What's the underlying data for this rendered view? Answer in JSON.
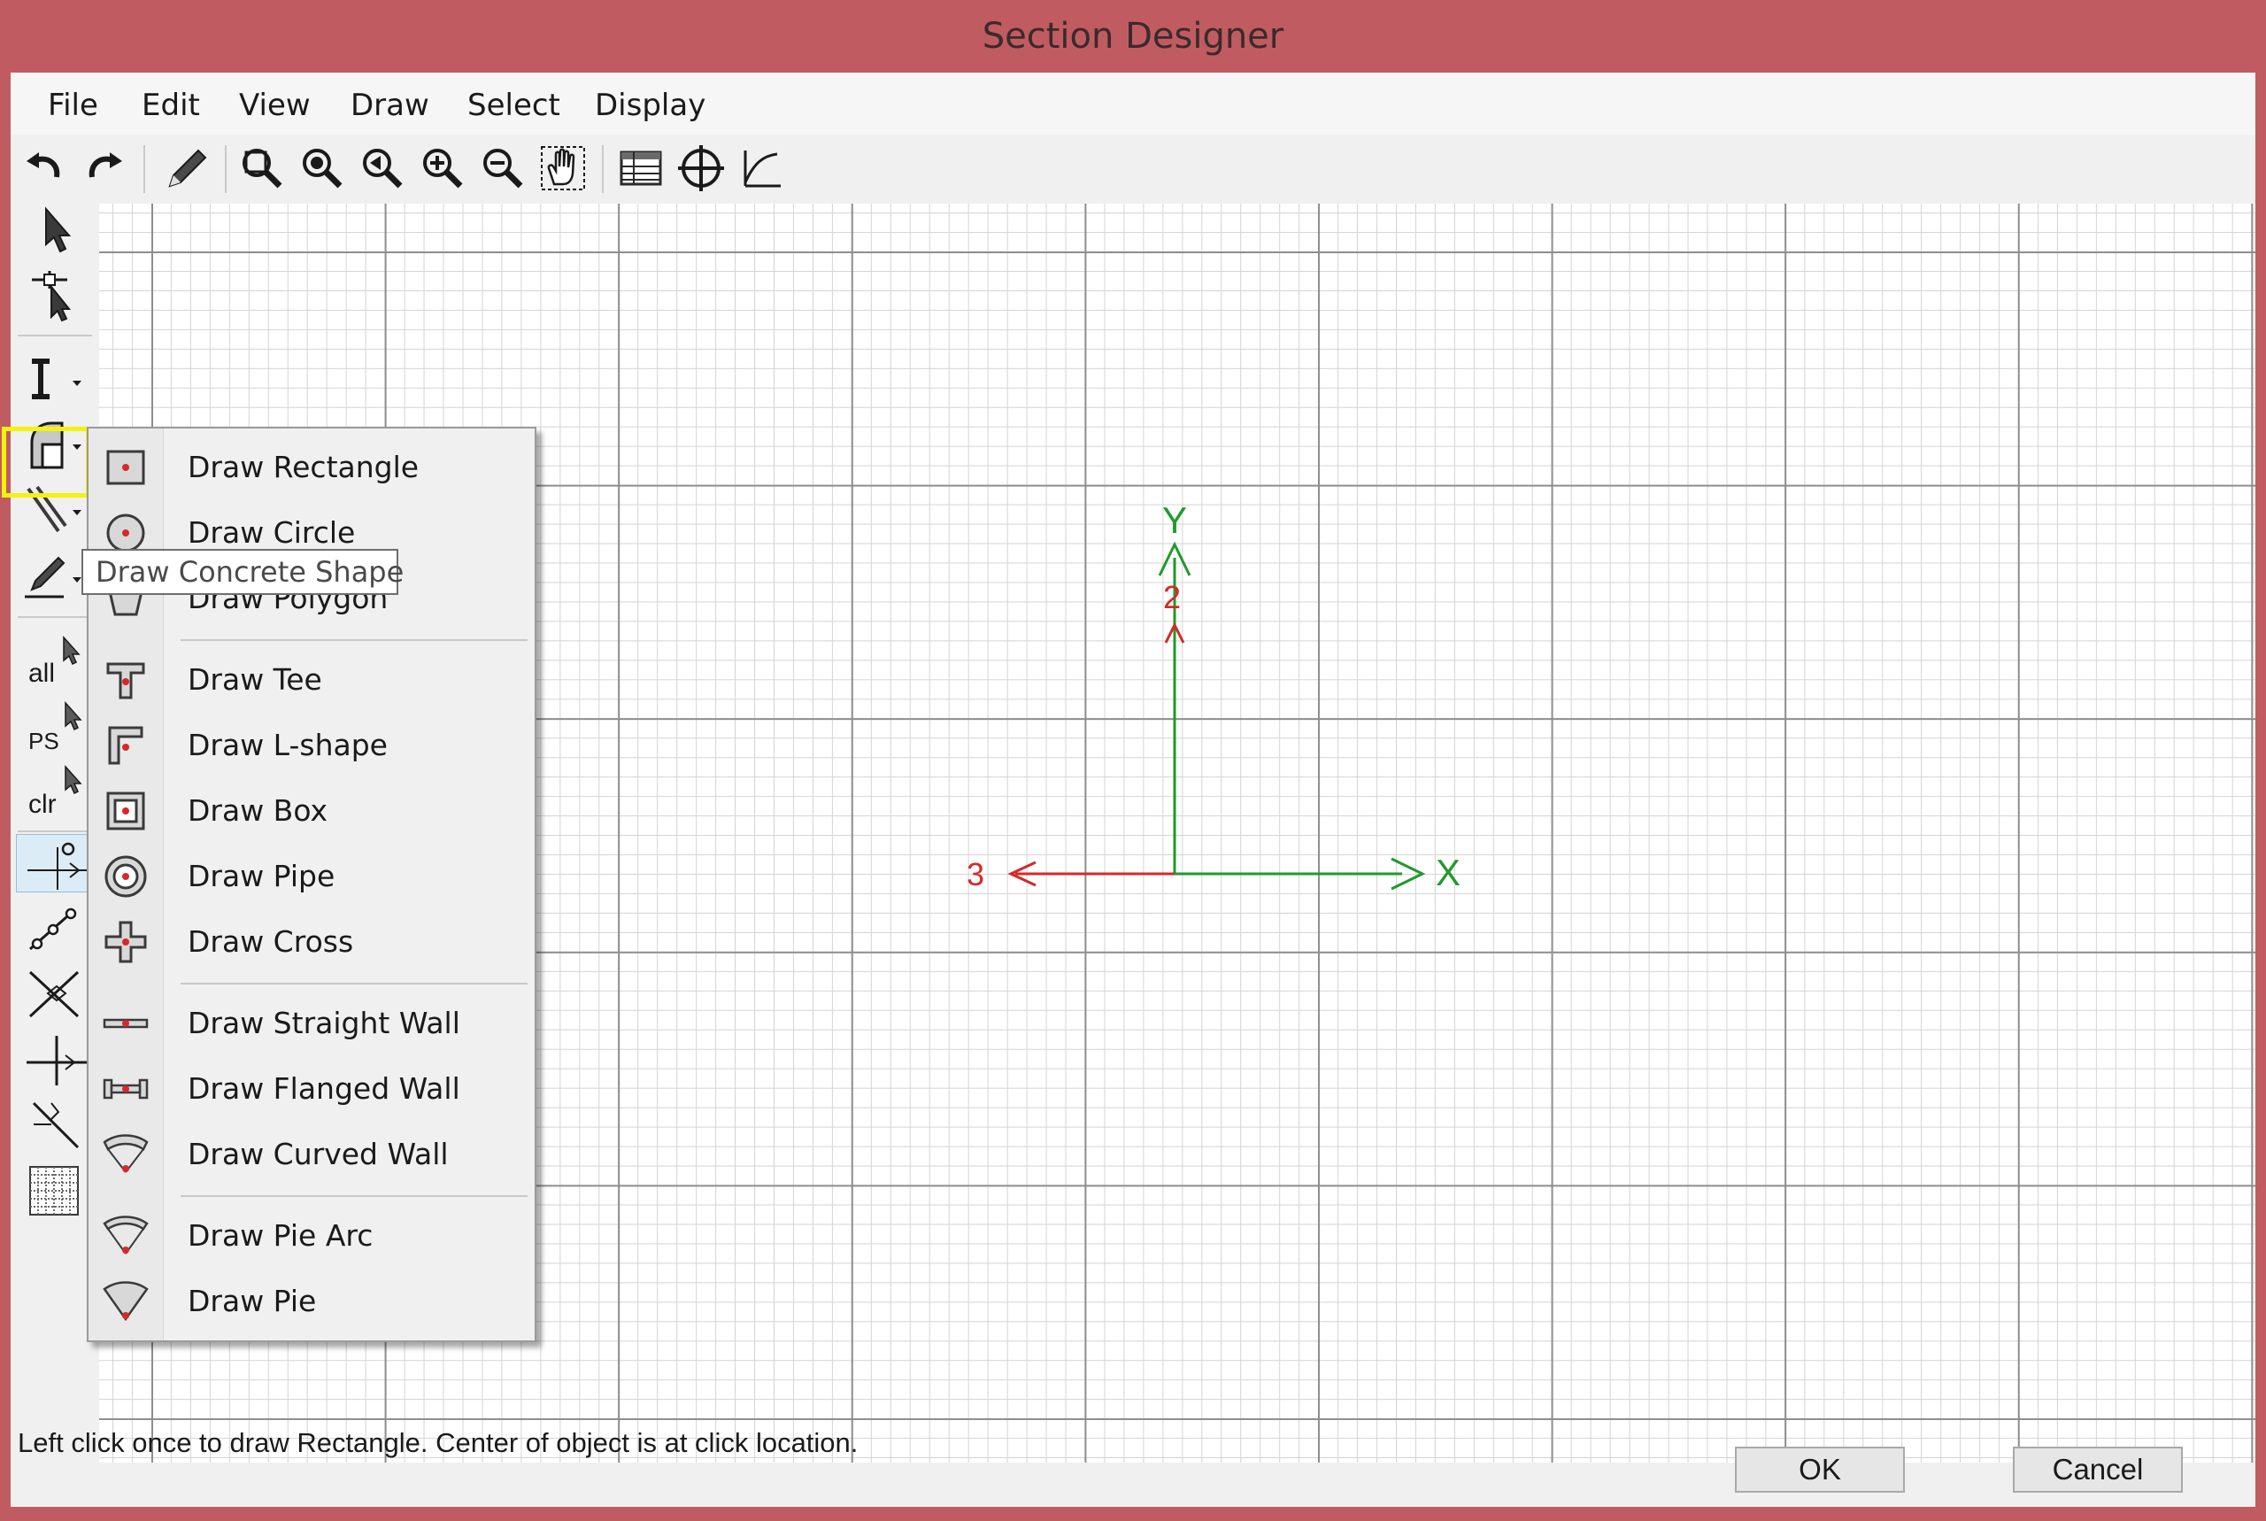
{
  "window": {
    "title": "Section Designer"
  },
  "menu": [
    "File",
    "Edit",
    "View",
    "Draw",
    "Select",
    "Display"
  ],
  "toolbar_icons": [
    "undo-icon",
    "redo-icon",
    "pencil-icon",
    "zoom-window-icon",
    "zoom-restore-icon",
    "zoom-previous-icon",
    "zoom-in-icon",
    "zoom-out-icon",
    "pan-icon",
    "table-icon",
    "crosshair-icon",
    "curve-icon"
  ],
  "left_toolbar": {
    "text_buttons": {
      "all": "all",
      "ps": "PS",
      "clr": "clr"
    }
  },
  "dropdown": {
    "items": [
      {
        "label": "Draw Rectangle",
        "icon": "rectangle-icon"
      },
      {
        "label": "Draw Circle",
        "icon": "circle-icon"
      },
      {
        "label": "Draw Polygon",
        "icon": "polygon-icon"
      },
      {
        "label": "Draw Tee",
        "icon": "tee-icon"
      },
      {
        "label": "Draw L-shape",
        "icon": "l-shape-icon"
      },
      {
        "label": "Draw Box",
        "icon": "box-icon"
      },
      {
        "label": "Draw Pipe",
        "icon": "pipe-icon"
      },
      {
        "label": "Draw Cross",
        "icon": "cross-icon"
      },
      {
        "label": "Draw Straight Wall",
        "icon": "straight-wall-icon"
      },
      {
        "label": "Draw Flanged Wall",
        "icon": "flanged-wall-icon"
      },
      {
        "label": "Draw Curved Wall",
        "icon": "curved-wall-icon"
      },
      {
        "label": "Draw Pie Arc",
        "icon": "pie-arc-icon"
      },
      {
        "label": "Draw Pie",
        "icon": "pie-icon"
      }
    ]
  },
  "tooltip": "Draw Concrete Shape",
  "axes": {
    "x_label": "X",
    "y_label": "Y",
    "axis2_label": "2",
    "axis3_label": "3"
  },
  "colors": {
    "title_bar": "#c05c61",
    "highlight": "#f5f20d",
    "axis_green": "#1f9a2c",
    "axis_red": "#d42a2a"
  },
  "status": {
    "text": "Left click once to draw Rectangle. Center of object is at click location."
  },
  "buttons": {
    "ok": "OK",
    "cancel": "Cancel"
  }
}
